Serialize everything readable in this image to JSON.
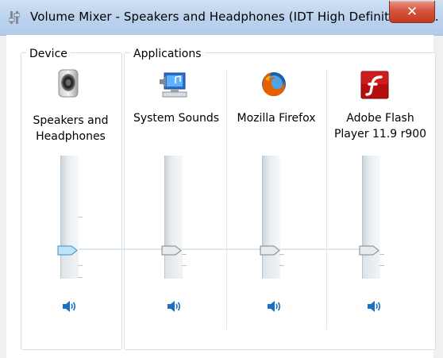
{
  "window": {
    "title": "Volume Mixer - Speakers and Headphones (IDT High Definition Au...",
    "close_label": "✕"
  },
  "device": {
    "group_label": "Device",
    "label_line1": "Speakers and",
    "label_line2": "Headphones",
    "icon": "speaker-icon",
    "level": 0.25
  },
  "applications": {
    "group_label": "Applications",
    "items": [
      {
        "label_line1": "System Sounds",
        "label_line2": "",
        "icon": "system-sounds-icon",
        "level": 0.25
      },
      {
        "label_line1": "Mozilla Firefox",
        "label_line2": "",
        "icon": "firefox-icon",
        "level": 0.25
      },
      {
        "label_line1": "Adobe Flash",
        "label_line2": "Player 11.9 r900",
        "icon": "flash-icon",
        "level": 0.25
      }
    ]
  },
  "colors": {
    "accent": "#1e6fc0",
    "device_thumb": "#bfe4f7"
  }
}
